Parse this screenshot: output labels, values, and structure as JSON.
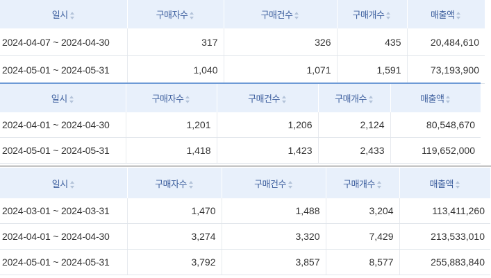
{
  "headers": {
    "date": "일시",
    "buyers": "구매자수",
    "orders": "구매건수",
    "items": "구매개수",
    "sales": "매출액"
  },
  "tables": [
    {
      "rows": [
        {
          "period": "2024-04-07 ~ 2024-04-30",
          "buyers": "317",
          "orders": "326",
          "items": "435",
          "sales": "20,484,610"
        },
        {
          "period": "2024-05-01 ~ 2024-05-31",
          "buyers": "1,040",
          "orders": "1,071",
          "items": "1,591",
          "sales": "73,193,900"
        }
      ]
    },
    {
      "rows": [
        {
          "period": "2024-04-01 ~ 2024-04-30",
          "buyers": "1,201",
          "orders": "1,206",
          "items": "2,124",
          "sales": "80,548,670"
        },
        {
          "period": "2024-05-01 ~ 2024-05-31",
          "buyers": "1,418",
          "orders": "1,423",
          "items": "2,433",
          "sales": "119,652,000"
        }
      ]
    },
    {
      "rows": [
        {
          "period": "2024-03-01 ~ 2024-03-31",
          "buyers": "1,470",
          "orders": "1,488",
          "items": "3,204",
          "sales": "113,411,260"
        },
        {
          "period": "2024-04-01 ~ 2024-04-30",
          "buyers": "3,274",
          "orders": "3,320",
          "items": "7,429",
          "sales": "213,533,010"
        },
        {
          "period": "2024-05-01 ~ 2024-05-31",
          "buyers": "3,792",
          "orders": "3,857",
          "items": "8,577",
          "sales": "255,883,840"
        }
      ]
    }
  ],
  "icons": {
    "sort": "sort-up-down-icon"
  },
  "colors": {
    "header_bg": "#e8f0fb",
    "header_text": "#3d5f9e",
    "accent_line": "#6d9ad6"
  }
}
